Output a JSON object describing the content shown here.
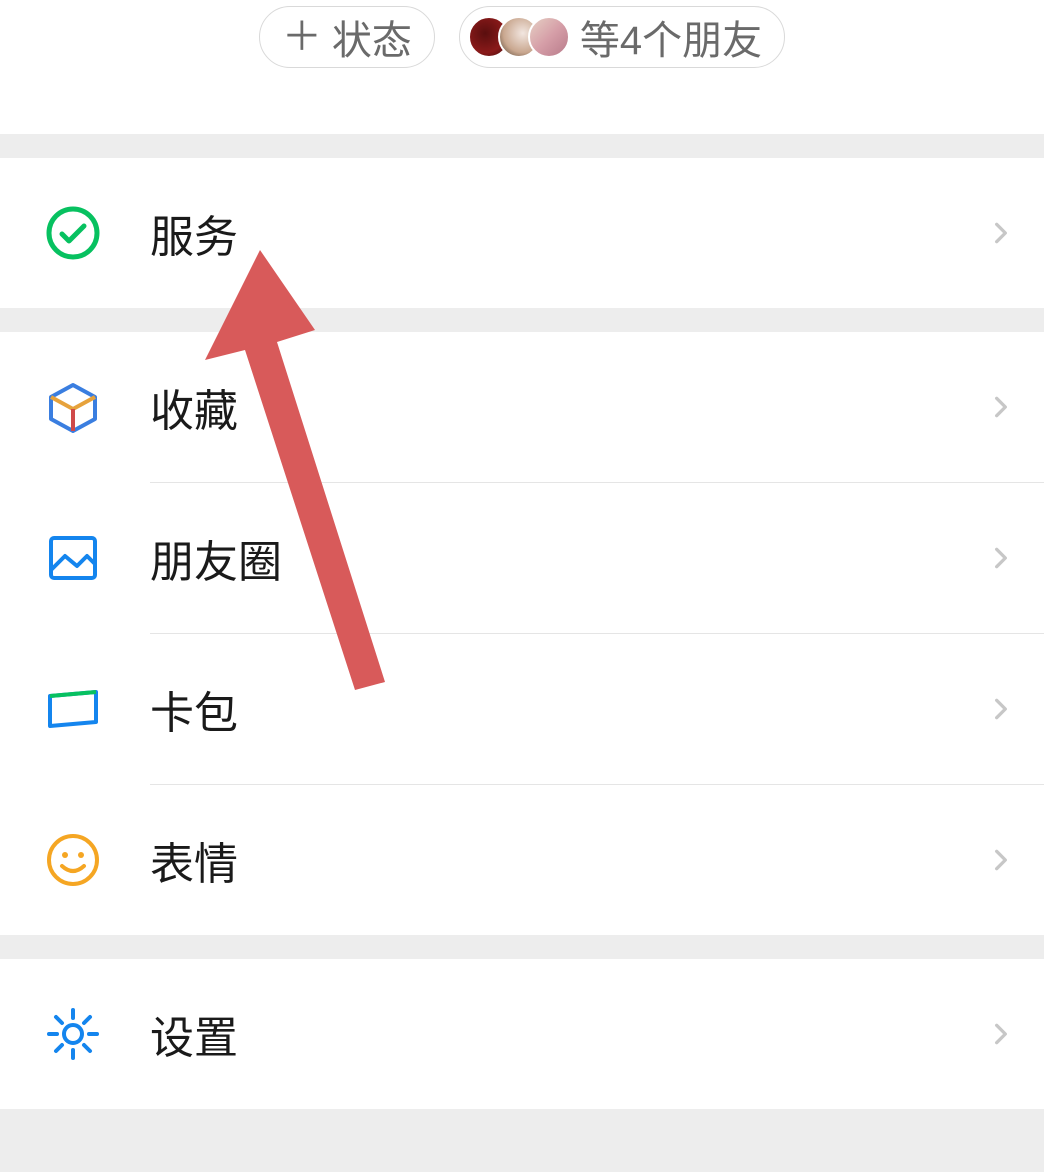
{
  "header": {
    "status_button_label": "状态",
    "friends_label": "等4个朋友"
  },
  "menu": {
    "services": "服务",
    "favorites": "收藏",
    "moments": "朋友圈",
    "cards": "卡包",
    "stickers": "表情",
    "settings": "设置"
  },
  "annotation": {
    "type": "arrow-pointer",
    "target": "services"
  }
}
